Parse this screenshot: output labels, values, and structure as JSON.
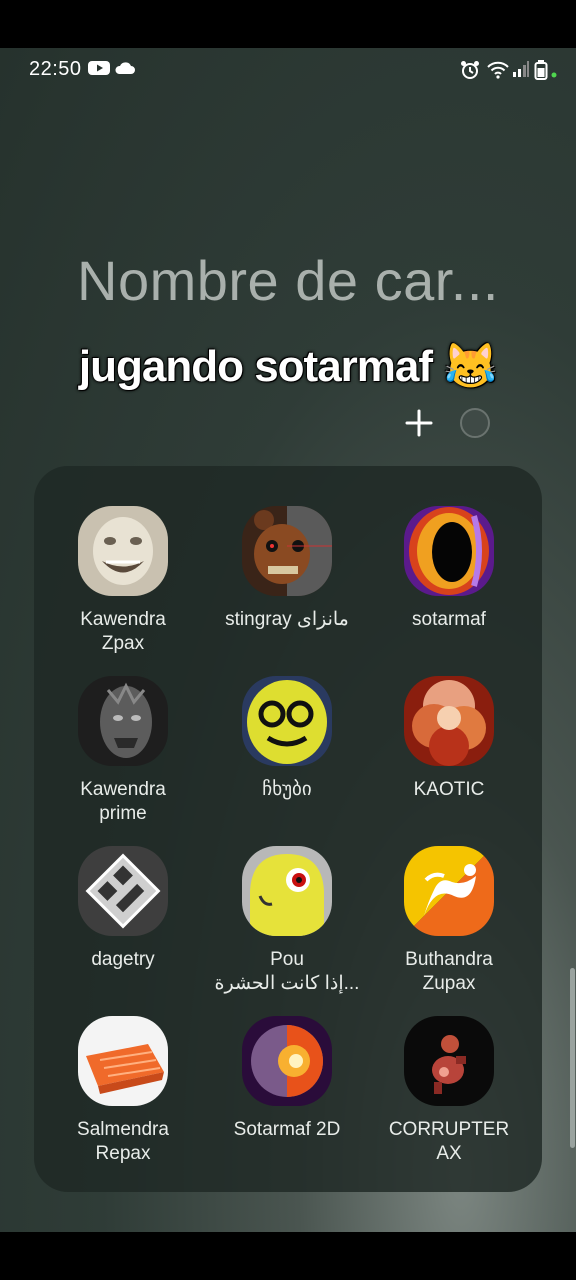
{
  "status_bar": {
    "time": "22:50"
  },
  "folder": {
    "title": "Nombre de car...",
    "apps": [
      {
        "label": "Kawendra\nZpax",
        "icon": "grinning-creature-icon"
      },
      {
        "label": "stingray مانزاى",
        "icon": "animatronic-bear-icon"
      },
      {
        "label": "sotarmaf",
        "icon": "fire-portal-icon"
      },
      {
        "label": "Kawendra\nprime",
        "icon": "dark-creature-icon"
      },
      {
        "label": "ჩხუბი",
        "icon": "yellow-face-icon"
      },
      {
        "label": "KAOTIC",
        "icon": "explosion-icon"
      },
      {
        "label": "dagetry",
        "icon": "geometry-cube-icon"
      },
      {
        "label": "Pou\nإذا كانت الحشرة...",
        "icon": "pou-icon"
      },
      {
        "label": "Buthandra\nZupax",
        "icon": "dragon-flag-icon"
      },
      {
        "label": "Salmendra\nRepax",
        "icon": "salmon-icon"
      },
      {
        "label": "Sotarmaf 2D",
        "icon": "fire-orb-icon"
      },
      {
        "label": "CORRUPTER\nAX",
        "icon": "corrupted-figure-icon"
      }
    ]
  },
  "caption": {
    "text": "jugando sotarmaf",
    "emoji": "😹"
  }
}
